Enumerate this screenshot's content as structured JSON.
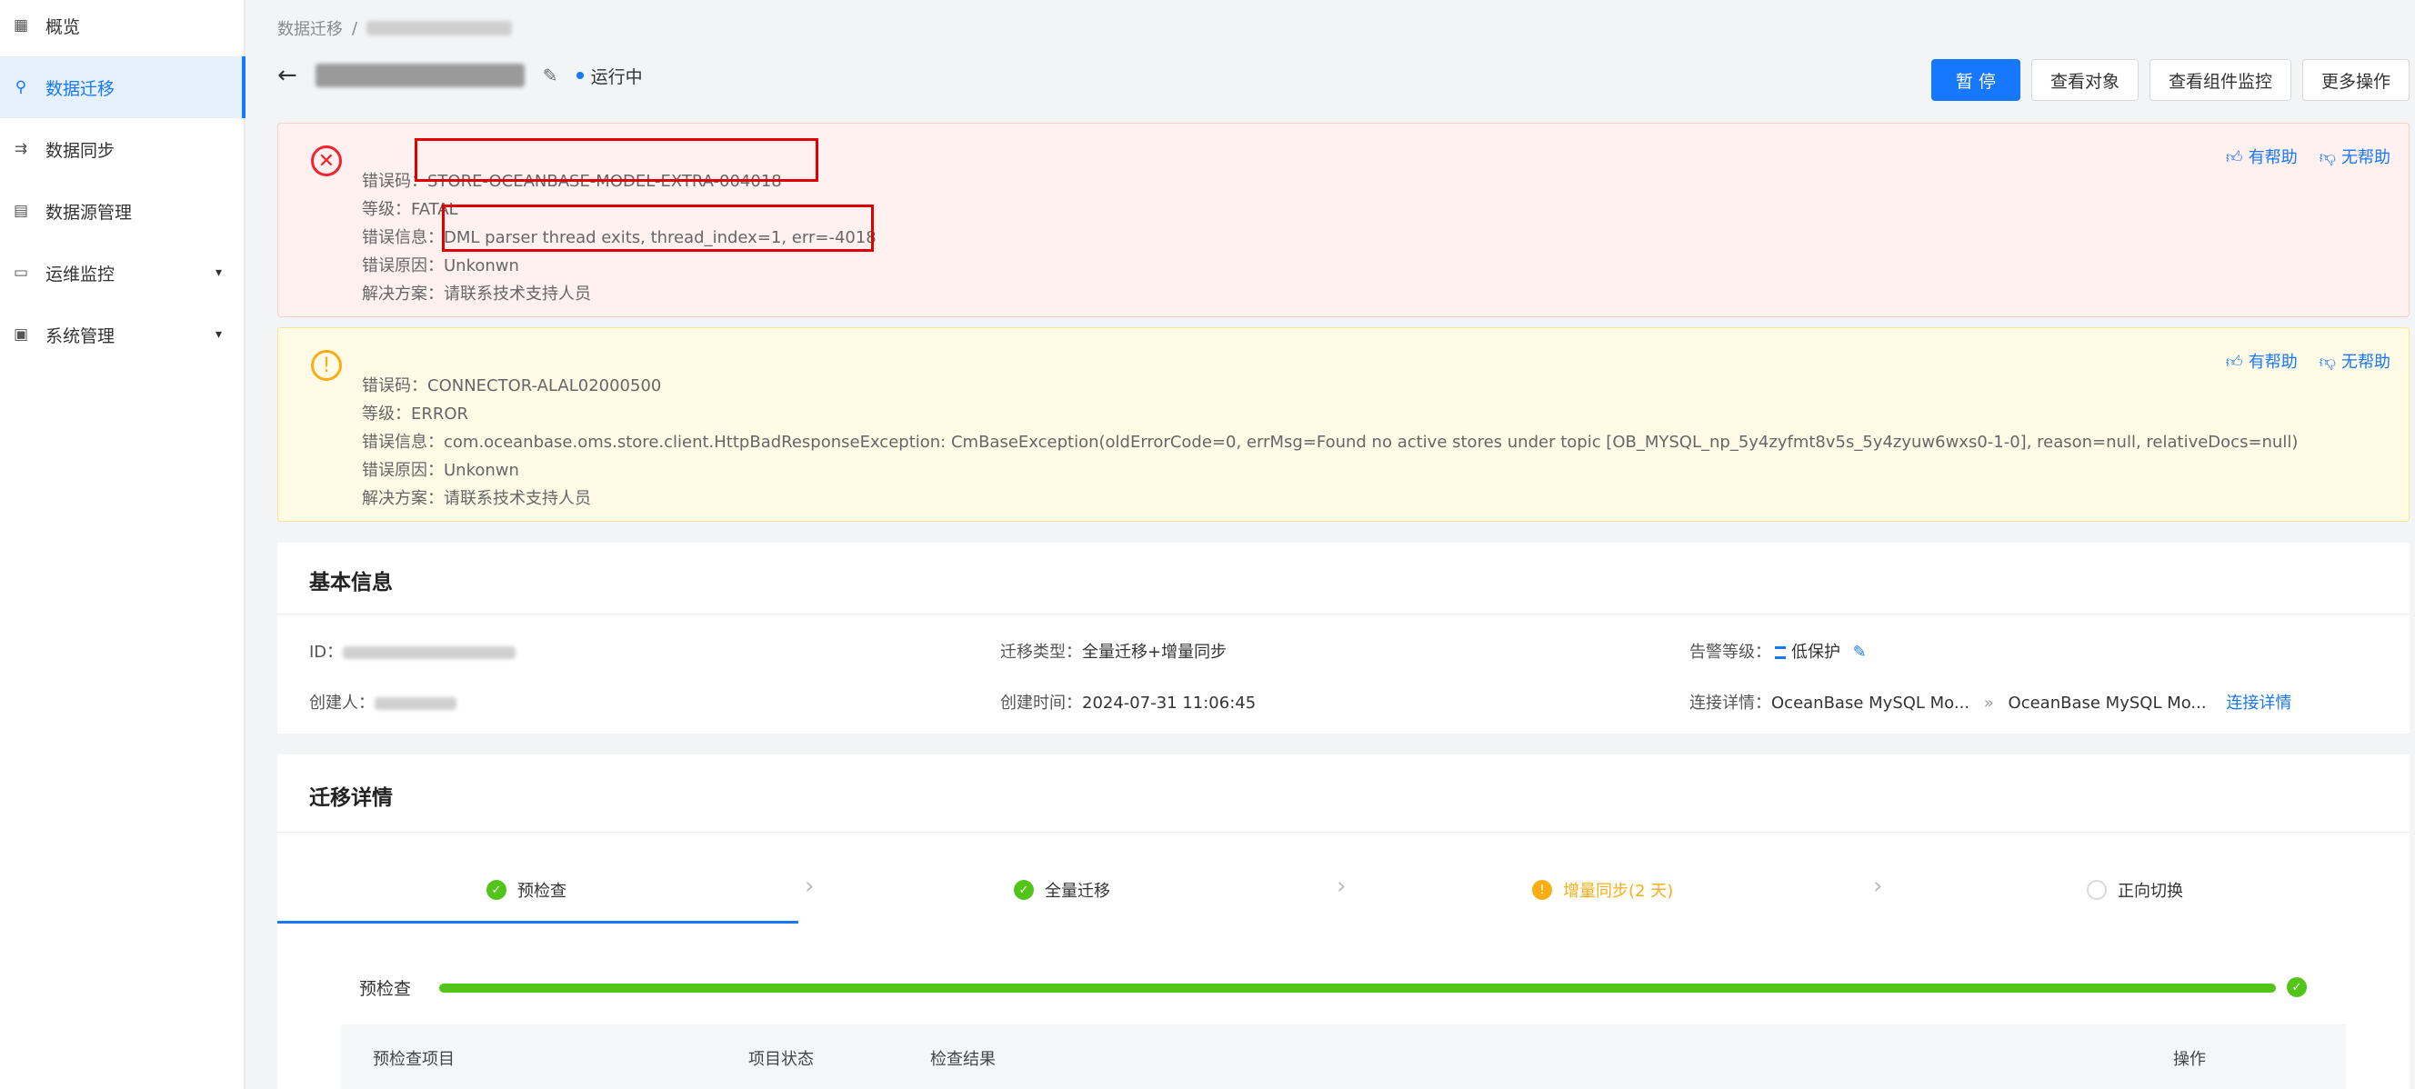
{
  "sidebar": {
    "items": [
      {
        "label": "概览",
        "icon": "grid-icon"
      },
      {
        "label": "数据迁移",
        "icon": "migrate-icon",
        "active": true
      },
      {
        "label": "数据同步",
        "icon": "sync-icon"
      },
      {
        "label": "数据源管理",
        "icon": "datasource-icon"
      },
      {
        "label": "运维监控",
        "icon": "monitor-icon",
        "expandable": true
      },
      {
        "label": "系统管理",
        "icon": "system-icon",
        "expandable": true
      }
    ]
  },
  "breadcrumb": {
    "root": "数据迁移",
    "sep": "/"
  },
  "header": {
    "status": "运行中"
  },
  "actions": {
    "pause": "暂 停",
    "view_objects": "查看对象",
    "component_monitor": "查看组件监控",
    "more": "更多操作"
  },
  "alerts": {
    "helpful": "有帮助",
    "not_helpful": "无帮助",
    "error": {
      "code_label": "错误码：",
      "code": "STORE-OCEANBASE-MODEL-EXTRA-004018",
      "level": "等级：FATAL",
      "msg_label": "错误信息：",
      "msg": "DML parser thread exits, thread_index=1, err=-4018",
      "reason": "错误原因：Unkonwn",
      "solution": "解决方案：请联系技术支持人员"
    },
    "warning": {
      "code": "错误码：CONNECTOR-ALAL02000500",
      "level": "等级：ERROR",
      "msg": "错误信息：com.oceanbase.oms.store.client.HttpBadResponseException: CmBaseException(oldErrorCode=0, errMsg=Found no active stores under topic [OB_MYSQL_np_5y4zyfmt8v5s_5y4zyuw6wxs0-1-0], reason=null, relativeDocs=null)",
      "reason": "错误原因：Unkonwn",
      "solution": "解决方案：请联系技术支持人员"
    }
  },
  "basic": {
    "title": "基本信息",
    "id_label": "ID：",
    "creator_label": "创建人：",
    "type_label": "迁移类型：",
    "type_value": "全量迁移+增量同步",
    "created_label": "创建时间：",
    "created_value": "2024-07-31 11:06:45",
    "alarm_label": "告警等级：",
    "alarm_value": "低保护",
    "conn_label": "连接详情：",
    "conn_src": "OceanBase MySQL Mo...",
    "conn_arrow": "»",
    "conn_dst": "OceanBase MySQL Mo...",
    "conn_link": "连接详情"
  },
  "detail": {
    "title": "迁移详情",
    "steps": [
      {
        "label": "预检查",
        "state": "done"
      },
      {
        "label": "全量迁移",
        "state": "done"
      },
      {
        "label": "增量同步(2 天)",
        "state": "warning"
      },
      {
        "label": "正向切换",
        "state": "pending"
      }
    ],
    "precheck_label": "预检查",
    "precheck_progress": 1.0,
    "table_headers": [
      "预检查项目",
      "项目状态",
      "检查结果",
      "操作"
    ]
  },
  "colors": {
    "primary": "#1677ff",
    "success": "#52c41a",
    "warning": "#faad14",
    "danger": "#f5222d"
  }
}
